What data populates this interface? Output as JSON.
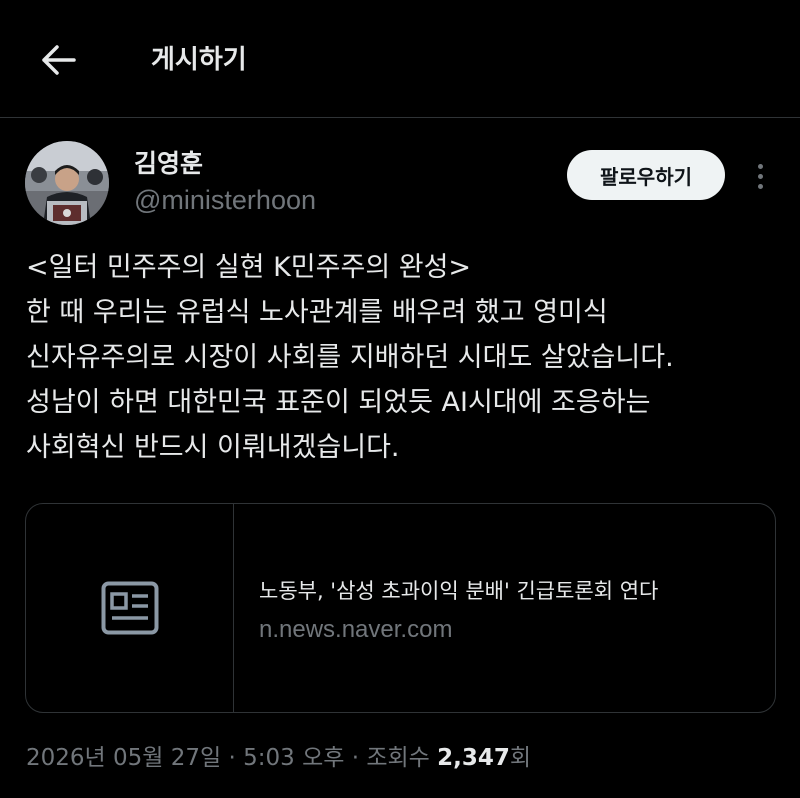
{
  "header": {
    "back_icon": "arrow-left-icon",
    "title": "게시하기"
  },
  "author": {
    "name": "김영훈",
    "handle": "@ministerhoon",
    "follow_label": "팔로우하기",
    "more_icon": "more-vertical-icon"
  },
  "tweet": {
    "lines": [
      "<일터 민주주의 실현 K민주주의 완성>",
      "한 때 우리는 유럽식 노사관계를 배우려 했고 영미식",
      "신자유주의로 시장이 사회를 지배하던 시대도 살았습니다.",
      "성남이 하면 대한민국 표준이 되었듯 AI시대에 조응하는",
      "사회혁신 반드시 이뤄내겠습니다."
    ]
  },
  "link_card": {
    "thumb_icon": "article-icon",
    "title": "노동부, '삼성 초과이익 분배' 긴급토론회 연다",
    "domain": "n.news.naver.com"
  },
  "meta": {
    "date": "2026년 05월 27일",
    "sep1": " · ",
    "time": "5:03 오후",
    "sep2": " · ",
    "views_label": "조회수 ",
    "views_count": "2,347",
    "views_suffix": "회"
  },
  "colors": {
    "background": "#000000",
    "text_primary": "#e7e9ea",
    "text_secondary": "#71767b",
    "border": "#2f3336",
    "button_bg": "#eff3f4"
  }
}
